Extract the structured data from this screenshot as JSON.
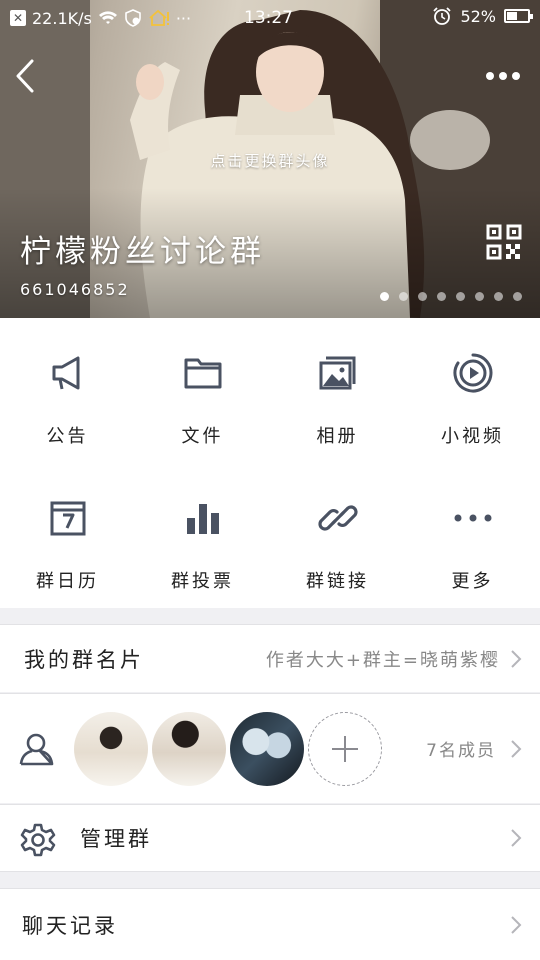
{
  "status_bar": {
    "speed": "22.1K/s",
    "time": "13:27",
    "battery": "52%",
    "battery_level": 0.52,
    "more": "···"
  },
  "header": {
    "change_avatar_hint": "点击更换群头像",
    "group_name": "柠檬粉丝讨论群",
    "group_id": "661046852",
    "carousel_pages": 8,
    "carousel_active": 0
  },
  "features": [
    {
      "label": "公告",
      "icon": "megaphone-icon"
    },
    {
      "label": "文件",
      "icon": "folder-icon"
    },
    {
      "label": "相册",
      "icon": "album-icon"
    },
    {
      "label": "小视频",
      "icon": "video-icon"
    },
    {
      "label": "群日历",
      "icon": "calendar-icon"
    },
    {
      "label": "群投票",
      "icon": "bar-chart-icon"
    },
    {
      "label": "群链接",
      "icon": "link-icon"
    },
    {
      "label": "更多",
      "icon": "more-icon"
    }
  ],
  "my_card": {
    "title": "我的群名片",
    "value": "作者大大+群主=晓萌紫樱"
  },
  "members": {
    "count_text": "7名成员"
  },
  "manage": {
    "title": "管理群"
  },
  "chat_history": {
    "title": "聊天记录"
  },
  "colors": {
    "icon": "#4a5262",
    "secondary_text": "#888888",
    "background": "#f0f0f3"
  }
}
